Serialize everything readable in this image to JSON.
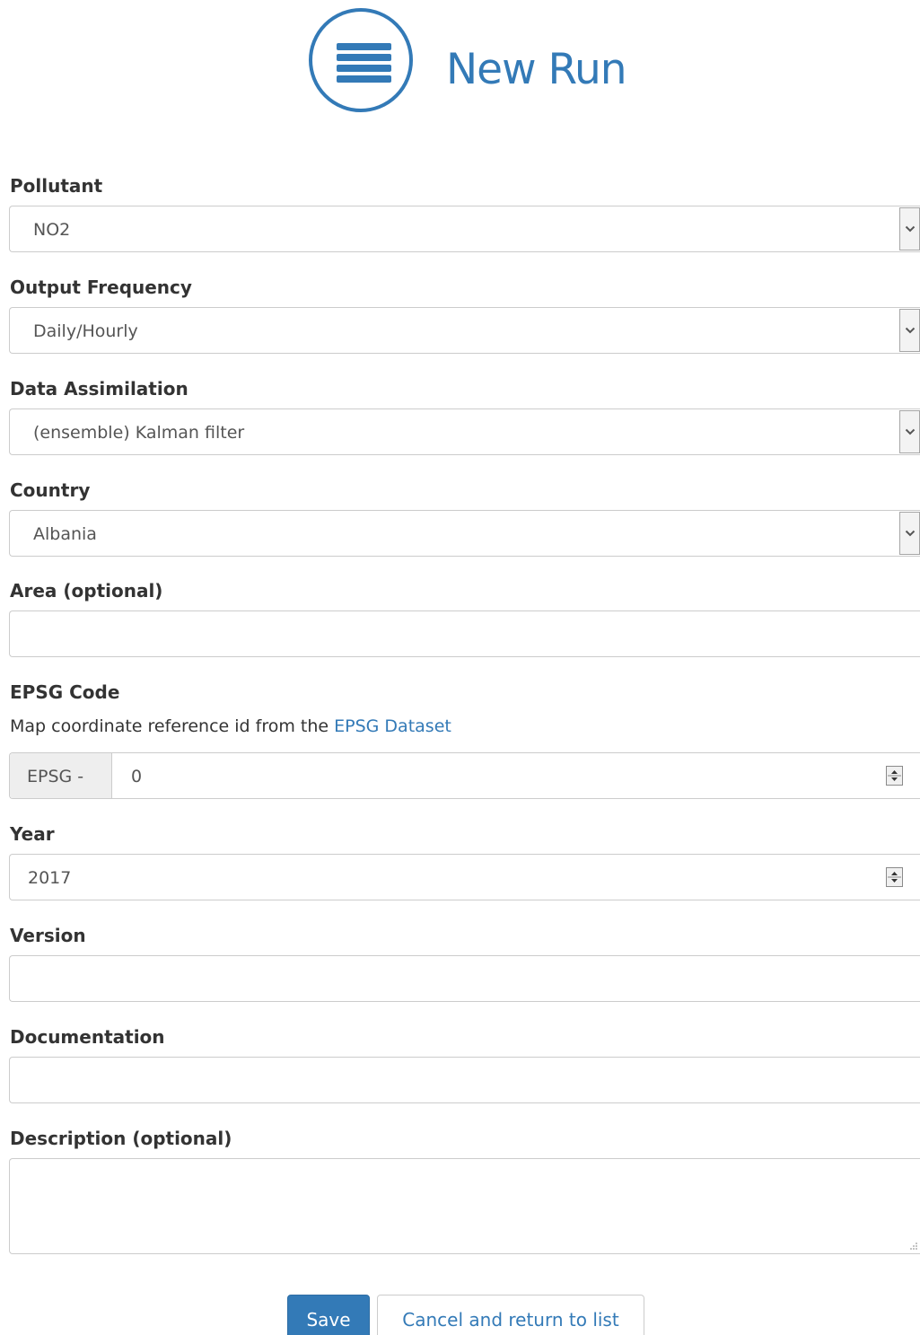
{
  "header": {
    "title": "New Run",
    "logo_icon": "list-icon",
    "accent_color": "#337ab7"
  },
  "form": {
    "pollutant": {
      "label": "Pollutant",
      "value": "NO2"
    },
    "output_frequency": {
      "label": "Output Frequency",
      "value": "Daily/Hourly"
    },
    "data_assimilation": {
      "label": "Data Assimilation",
      "value": "(ensemble) Kalman filter"
    },
    "country": {
      "label": "Country",
      "value": "Albania"
    },
    "area": {
      "label": "Area (optional)",
      "value": ""
    },
    "epsg": {
      "label": "EPSG Code",
      "help_text": "Map coordinate reference id from the ",
      "help_link": "EPSG Dataset",
      "addon": "EPSG -",
      "value": "0"
    },
    "year": {
      "label": "Year",
      "value": "2017"
    },
    "version": {
      "label": "Version",
      "value": ""
    },
    "documentation": {
      "label": "Documentation",
      "value": ""
    },
    "description": {
      "label": "Description (optional)",
      "value": ""
    }
  },
  "actions": {
    "save_label": "Save",
    "cancel_label": "Cancel and return to list"
  }
}
